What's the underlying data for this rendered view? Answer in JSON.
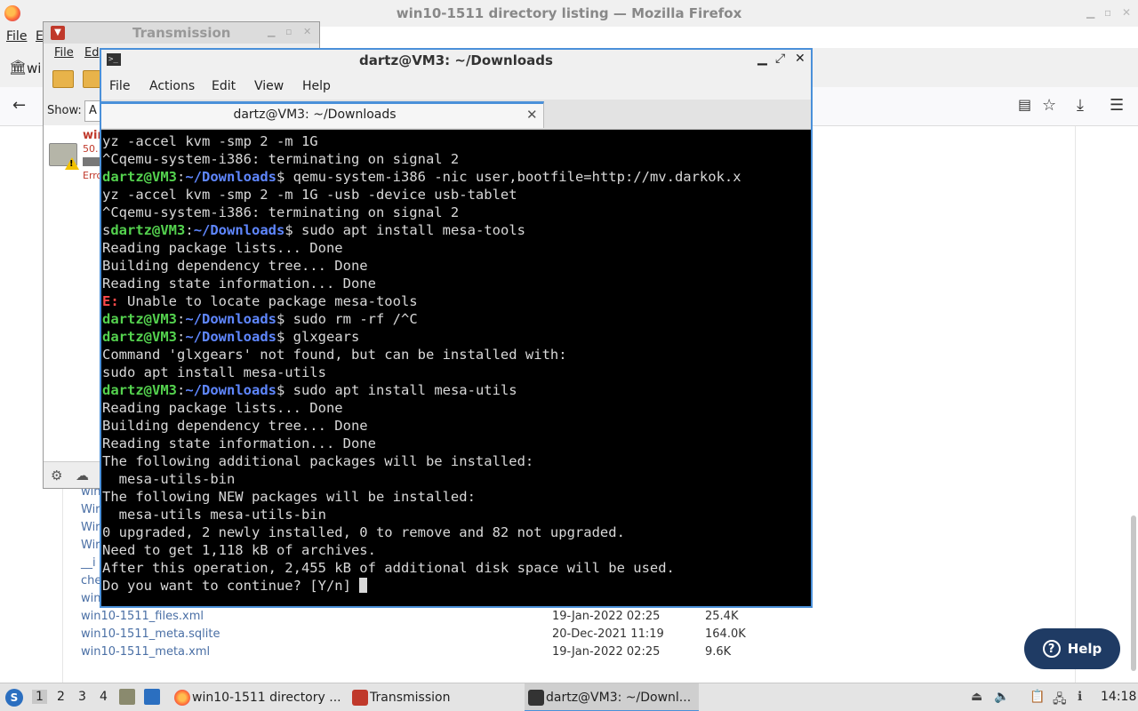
{
  "firefox": {
    "title": "win10-1511 directory listing — Mozilla Firefox",
    "menu_file": "File",
    "menu_edit_partial": "E",
    "tab_partial": "wi",
    "directory_rows": [
      {
        "name": "win10-1511_files.xml",
        "date": "19-Jan-2022 02:25",
        "size": "25.4K"
      },
      {
        "name": "win10-1511_meta.sqlite",
        "date": "20-Dec-2021 11:19",
        "size": "164.0K"
      },
      {
        "name": "win10-1511_meta.xml",
        "date": "19-Jan-2022 02:25",
        "size": "9.6K"
      }
    ],
    "truncated_rows": [
      "win",
      "Wir",
      "Wir",
      "Wir",
      "__i",
      "che",
      "win"
    ],
    "help_label": "Help"
  },
  "transmission": {
    "title": "Transmission",
    "menu_file": "File",
    "menu_edit_partial": "Ed",
    "show_label": "Show:",
    "show_value": "A",
    "torrent_name": "win",
    "torrent_size": "50.",
    "torrent_error": "Erro"
  },
  "terminal": {
    "title": "dartz@VM3: ~/Downloads",
    "menu": [
      "File",
      "Actions",
      "Edit",
      "View",
      "Help"
    ],
    "tab_label": "dartz@VM3: ~/Downloads",
    "prompt_user": "dartz@VM3",
    "prompt_path": "~/Downloads",
    "lines": [
      {
        "type": "out",
        "text": "yz -accel kvm -smp 2 -m 1G"
      },
      {
        "type": "out",
        "text": "^Cqemu-system-i386: terminating on signal 2"
      },
      {
        "type": "cmd",
        "text": " qemu-system-i386 -nic user,bootfile=http://mv.darkok.x"
      },
      {
        "type": "out",
        "text": "yz -accel kvm -smp 2 -m 1G -usb -device usb-tablet"
      },
      {
        "type": "out",
        "text": "^Cqemu-system-i386: terminating on signal 2"
      },
      {
        "type": "cmd",
        "prefix": "s",
        "text": " sudo apt install mesa-tools"
      },
      {
        "type": "out",
        "text": "Reading package lists... Done"
      },
      {
        "type": "out",
        "text": "Building dependency tree... Done"
      },
      {
        "type": "out",
        "text": "Reading state information... Done"
      },
      {
        "type": "err",
        "label": "E:",
        "text": " Unable to locate package mesa-tools"
      },
      {
        "type": "cmd",
        "text": " sudo rm -rf /^C"
      },
      {
        "type": "cmd",
        "text": " glxgears"
      },
      {
        "type": "out",
        "text": "Command 'glxgears' not found, but can be installed with:"
      },
      {
        "type": "out",
        "text": "sudo apt install mesa-utils"
      },
      {
        "type": "cmd",
        "text": " sudo apt install mesa-utils"
      },
      {
        "type": "out",
        "text": "Reading package lists... Done"
      },
      {
        "type": "out",
        "text": "Building dependency tree... Done"
      },
      {
        "type": "out",
        "text": "Reading state information... Done"
      },
      {
        "type": "out",
        "text": "The following additional packages will be installed:"
      },
      {
        "type": "out",
        "text": "  mesa-utils-bin"
      },
      {
        "type": "out",
        "text": "The following NEW packages will be installed:"
      },
      {
        "type": "out",
        "text": "  mesa-utils mesa-utils-bin"
      },
      {
        "type": "out",
        "text": "0 upgraded, 2 newly installed, 0 to remove and 82 not upgraded."
      },
      {
        "type": "out",
        "text": "Need to get 1,118 kB of archives."
      },
      {
        "type": "out",
        "text": "After this operation, 2,455 kB of additional disk space will be used."
      },
      {
        "type": "prompt",
        "text": "Do you want to continue? [Y/n] "
      }
    ]
  },
  "taskbar": {
    "workspaces": [
      "1",
      "2",
      "3",
      "4"
    ],
    "items": [
      {
        "label": "win10-1511 directory ..."
      },
      {
        "label": "Transmission"
      },
      {
        "label": "dartz@VM3: ~/Downl..."
      }
    ],
    "clock": "14:18"
  },
  "colors": {
    "prompt_blue": "#5f87ff",
    "error_red": "#ff4a4a",
    "focus_border": "#4a90d9",
    "help_button": "#1f3b64"
  }
}
